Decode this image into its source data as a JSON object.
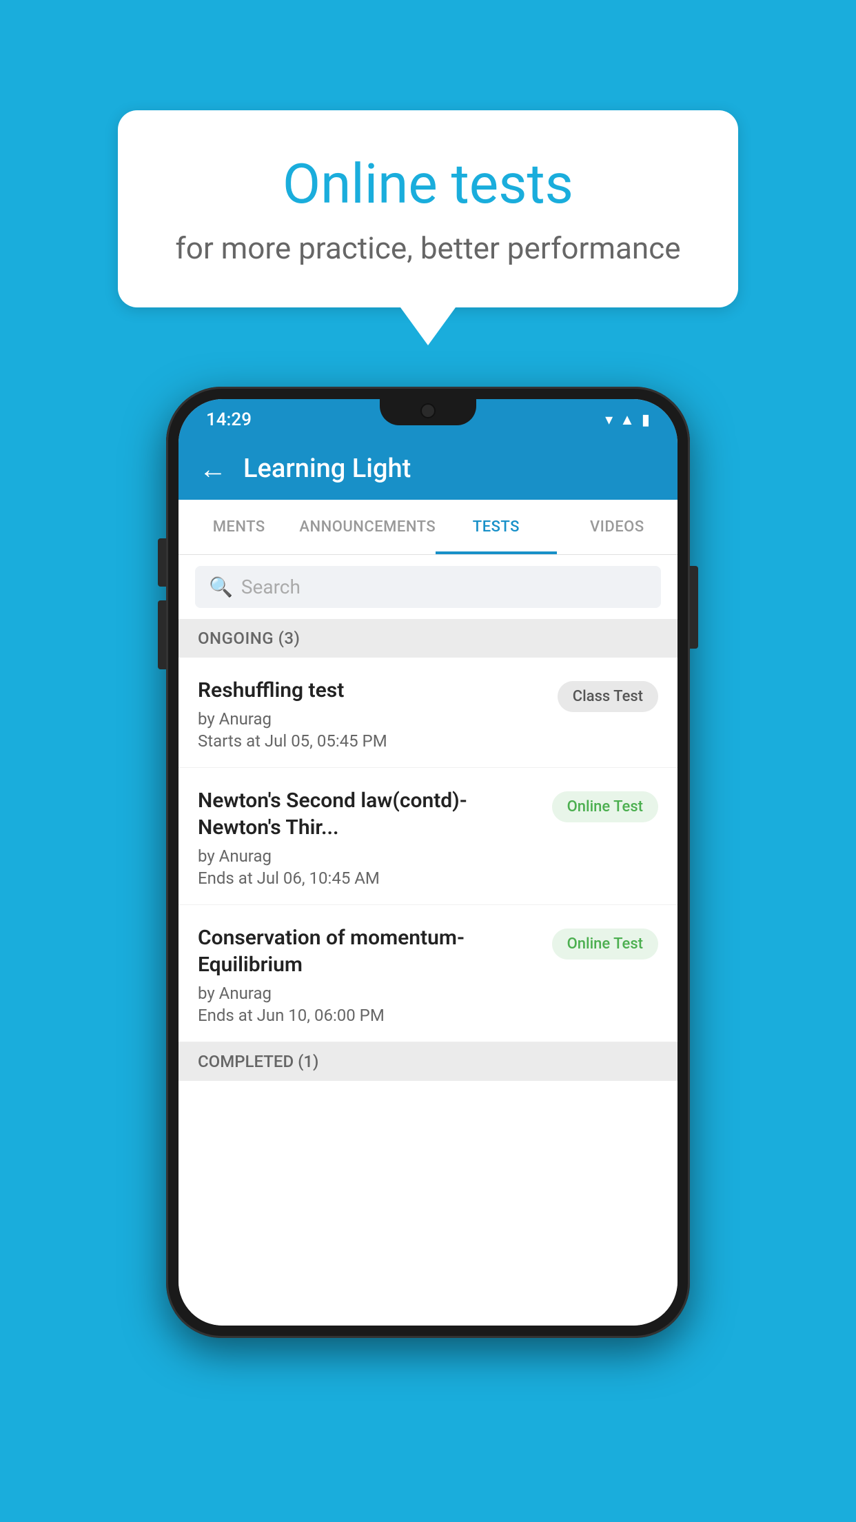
{
  "background_color": "#1AADDC",
  "speech_bubble": {
    "title": "Online tests",
    "subtitle": "for more practice, better performance"
  },
  "phone": {
    "status_bar": {
      "time": "14:29",
      "wifi": "▾",
      "signal": "▲",
      "battery": "▮"
    },
    "header": {
      "title": "Learning Light",
      "back_label": "←"
    },
    "tabs": [
      {
        "label": "MENTS",
        "active": false
      },
      {
        "label": "ANNOUNCEMENTS",
        "active": false
      },
      {
        "label": "TESTS",
        "active": true
      },
      {
        "label": "VIDEOS",
        "active": false
      }
    ],
    "search": {
      "placeholder": "Search"
    },
    "ongoing_section": {
      "label": "ONGOING (3)"
    },
    "test_items": [
      {
        "name": "Reshuffling test",
        "by": "by Anurag",
        "time": "Starts at  Jul 05, 05:45 PM",
        "badge": "Class Test",
        "badge_type": "class"
      },
      {
        "name": "Newton's Second law(contd)-Newton's Thir...",
        "by": "by Anurag",
        "time": "Ends at  Jul 06, 10:45 AM",
        "badge": "Online Test",
        "badge_type": "online"
      },
      {
        "name": "Conservation of momentum-Equilibrium",
        "by": "by Anurag",
        "time": "Ends at  Jun 10, 06:00 PM",
        "badge": "Online Test",
        "badge_type": "online"
      }
    ],
    "completed_section": {
      "label": "COMPLETED (1)"
    }
  }
}
